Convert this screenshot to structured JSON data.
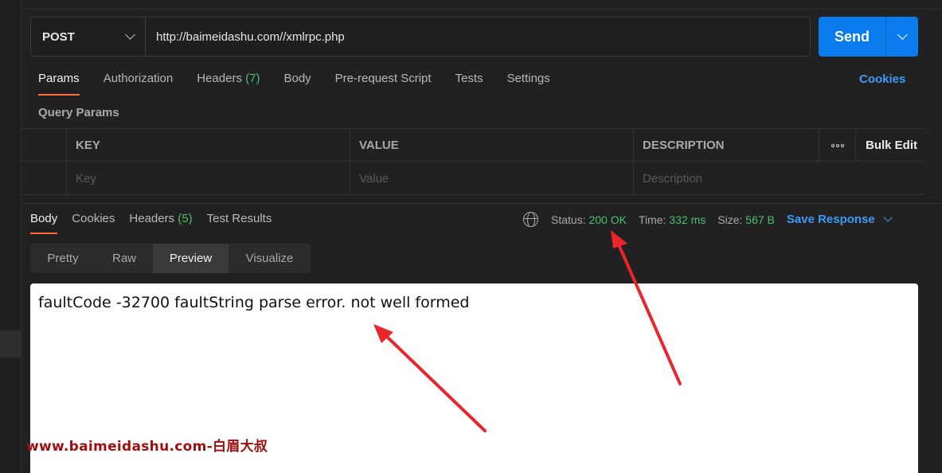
{
  "request": {
    "method": "POST",
    "url": "http://baimeidashu.com//xmlrpc.php",
    "send_label": "Send"
  },
  "request_tabs": [
    {
      "label": "Params",
      "count": ""
    },
    {
      "label": "Authorization",
      "count": ""
    },
    {
      "label": "Headers",
      "count": "(7)"
    },
    {
      "label": "Body",
      "count": ""
    },
    {
      "label": "Pre-request Script",
      "count": ""
    },
    {
      "label": "Tests",
      "count": ""
    },
    {
      "label": "Settings",
      "count": ""
    }
  ],
  "cookies_label": "Cookies",
  "query_params": {
    "title": "Query Params",
    "headers": {
      "key": "KEY",
      "value": "VALUE",
      "description": "DESCRIPTION",
      "bulk_edit": "Bulk Edit"
    },
    "placeholders": {
      "key": "Key",
      "value": "Value",
      "description": "Description"
    }
  },
  "response_tabs": [
    {
      "label": "Body",
      "count": ""
    },
    {
      "label": "Cookies",
      "count": ""
    },
    {
      "label": "Headers",
      "count": "(5)"
    },
    {
      "label": "Test Results",
      "count": ""
    }
  ],
  "response_meta": {
    "status_label": "Status:",
    "status_value": "200 OK",
    "time_label": "Time:",
    "time_value": "332 ms",
    "size_label": "Size:",
    "size_value": "567 B",
    "save_label": "Save Response"
  },
  "view_modes": [
    "Pretty",
    "Raw",
    "Preview",
    "Visualize"
  ],
  "preview_text": "faultCode -32700 faultString parse error. not well formed",
  "watermark": "www.baimeidashu.com-白眉大叔",
  "colors": {
    "accent_tab": "#ff6c37",
    "send_button": "#097bed",
    "link": "#3e9bf5",
    "status_ok": "#49c16e",
    "annotation_arrow": "#e8262b",
    "watermark": "#a01010"
  }
}
